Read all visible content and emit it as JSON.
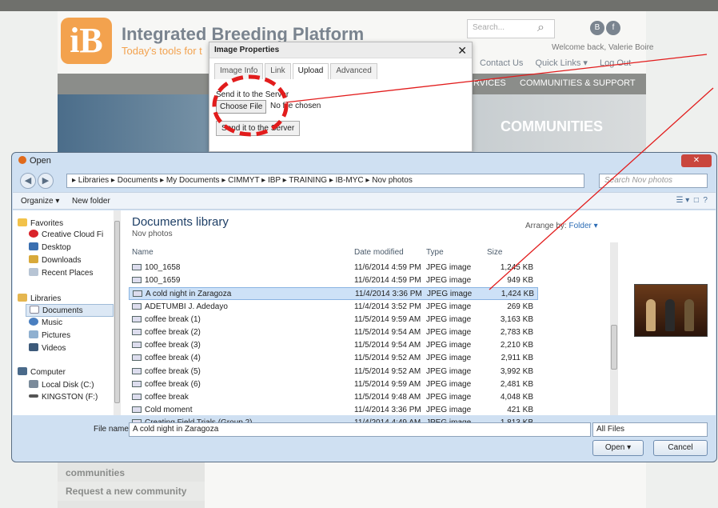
{
  "site": {
    "brand": "Integrated Breeding Platform",
    "tagline": "Today's tools for t",
    "search_placeholder": "Search...",
    "welcome": "Welcome back, Valerie Boire",
    "links": [
      "Contact Us",
      "Quick Links ▾",
      "Log Out"
    ],
    "nav": [
      "RVICES",
      "COMMUNITIES & SUPPORT"
    ],
    "banner": "COMMUNITIES",
    "sidebar": [
      "communities",
      "Request a new community"
    ]
  },
  "image_props": {
    "title": "Image Properties",
    "tabs": [
      "Image Info",
      "Link",
      "Upload",
      "Advanced"
    ],
    "send_label": "Send it to the Server",
    "choose_btn": "Choose File",
    "no_file": "No file chosen",
    "send_btn": "Send it to the Server"
  },
  "open_dialog": {
    "title": "Open",
    "breadcrumb": "▸ Libraries ▸ Documents ▸ My Documents ▸ CIMMYT ▸ IBP ▸ TRAINING ▸ IB-MYC ▸ Nov photos",
    "search_placeholder": "Search Nov photos",
    "organize": "Organize ▾",
    "new_folder": "New folder",
    "nav": {
      "favorites": "Favorites",
      "fav_items": [
        "Creative Cloud Fi",
        "Desktop",
        "Downloads",
        "Recent Places"
      ],
      "libraries": "Libraries",
      "lib_items": [
        "Documents",
        "Music",
        "Pictures",
        "Videos"
      ],
      "computer": "Computer",
      "comp_items": [
        "Local Disk (C:)",
        "KINGSTON (F:)"
      ]
    },
    "library_title": "Documents library",
    "library_sub": "Nov photos",
    "arrange_label": "Arrange by:",
    "arrange_value": "Folder ▾",
    "columns": [
      "Name",
      "Date modified",
      "Type",
      "Size"
    ],
    "files": [
      {
        "name": "100_1658",
        "date": "11/6/2014 4:59 PM",
        "type": "JPEG image",
        "size": "1,245 KB"
      },
      {
        "name": "100_1659",
        "date": "11/6/2014 4:59 PM",
        "type": "JPEG image",
        "size": "949 KB"
      },
      {
        "name": "A cold night in Zaragoza",
        "date": "11/4/2014 3:36 PM",
        "type": "JPEG image",
        "size": "1,424 KB"
      },
      {
        "name": "ADETUMBI J. Adedayo",
        "date": "11/4/2014 3:52 PM",
        "type": "JPEG image",
        "size": "269 KB"
      },
      {
        "name": "coffee break (1)",
        "date": "11/5/2014 9:59 AM",
        "type": "JPEG image",
        "size": "3,163 KB"
      },
      {
        "name": "coffee break (2)",
        "date": "11/5/2014 9:54 AM",
        "type": "JPEG image",
        "size": "2,783 KB"
      },
      {
        "name": "coffee break (3)",
        "date": "11/5/2014 9:54 AM",
        "type": "JPEG image",
        "size": "2,210 KB"
      },
      {
        "name": "coffee break (4)",
        "date": "11/5/2014 9:52 AM",
        "type": "JPEG image",
        "size": "2,911 KB"
      },
      {
        "name": "coffee break (5)",
        "date": "11/5/2014 9:52 AM",
        "type": "JPEG image",
        "size": "3,992 KB"
      },
      {
        "name": "coffee break (6)",
        "date": "11/5/2014 9:59 AM",
        "type": "JPEG image",
        "size": "2,481 KB"
      },
      {
        "name": "coffee break",
        "date": "11/5/2014 9:48 AM",
        "type": "JPEG image",
        "size": "4,048 KB"
      },
      {
        "name": "Cold moment",
        "date": "11/4/2014 3:36 PM",
        "type": "JPEG image",
        "size": "421 KB"
      },
      {
        "name": "Creating Field Trials (Group 2)",
        "date": "11/4/2014 4:49 AM",
        "type": "JPEG image",
        "size": "1,813 KB"
      }
    ],
    "filename_label": "File name:",
    "filename": "A cold night in Zaragoza",
    "filetype": "All Files",
    "open_btn": "Open",
    "cancel_btn": "Cancel"
  },
  "colors": {
    "accent": "#f3a24e",
    "annotation": "#e21c1c"
  }
}
